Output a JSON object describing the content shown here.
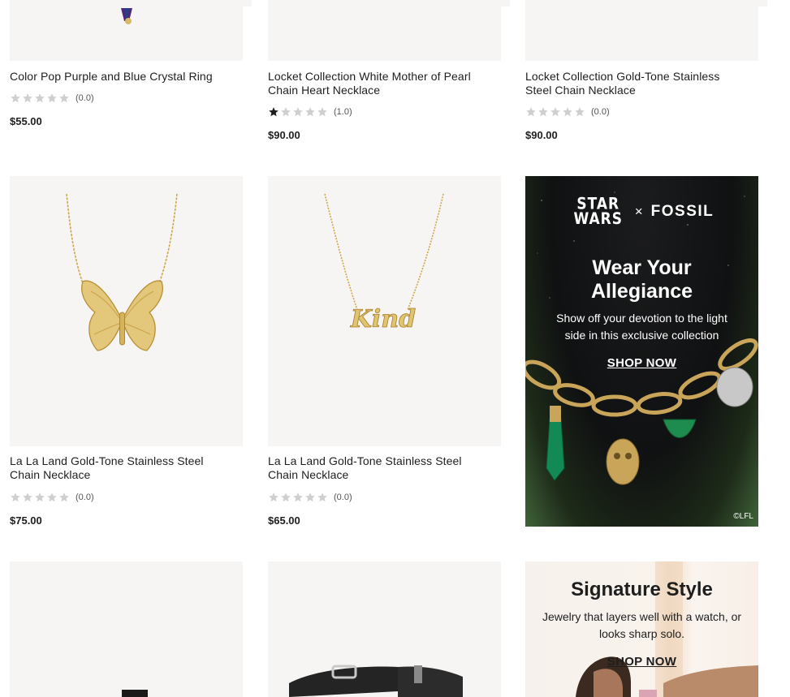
{
  "products_row1": [
    {
      "title": "Color Pop Purple and Blue Crystal Ring",
      "rating_text": "(0.0)",
      "rating": 0,
      "price": "$55.00"
    },
    {
      "title": "Locket Collection White Mother of Pearl Chain Heart Necklace",
      "rating_text": "(1.0)",
      "rating": 1,
      "price": "$90.00"
    },
    {
      "title": "Locket Collection Gold-Tone Stainless Steel Chain Necklace",
      "rating_text": "(0.0)",
      "rating": 0,
      "price": "$90.00"
    }
  ],
  "products_row2": [
    {
      "title": "La La Land Gold-Tone Stainless Steel Chain Necklace",
      "rating_text": "(0.0)",
      "rating": 0,
      "price": "$75.00"
    },
    {
      "title": "La La Land Gold-Tone Stainless Steel Chain Necklace",
      "rating_text": "(0.0)",
      "rating": 0,
      "price": "$65.00"
    }
  ],
  "promo_starwars": {
    "brand_left": "STAR WARS",
    "separator": "×",
    "brand_right": "FOSSIL",
    "heading": "Wear Your Allegiance",
    "body": "Show off your devotion to the light side in this exclusive collection",
    "cta": "SHOP NOW",
    "copyright": "©LFL"
  },
  "promo_signature": {
    "heading": "Signature Style",
    "body": "Jewelry that layers well with a watch, or looks sharp solo.",
    "cta": "SHOP NOW"
  },
  "pendant_text": "Kind",
  "colors": {
    "image_bg": "#f7f5f3",
    "star_filled": "#1e1e1e",
    "star_empty": "#cfcfcf",
    "gold": "#d6b35a"
  }
}
